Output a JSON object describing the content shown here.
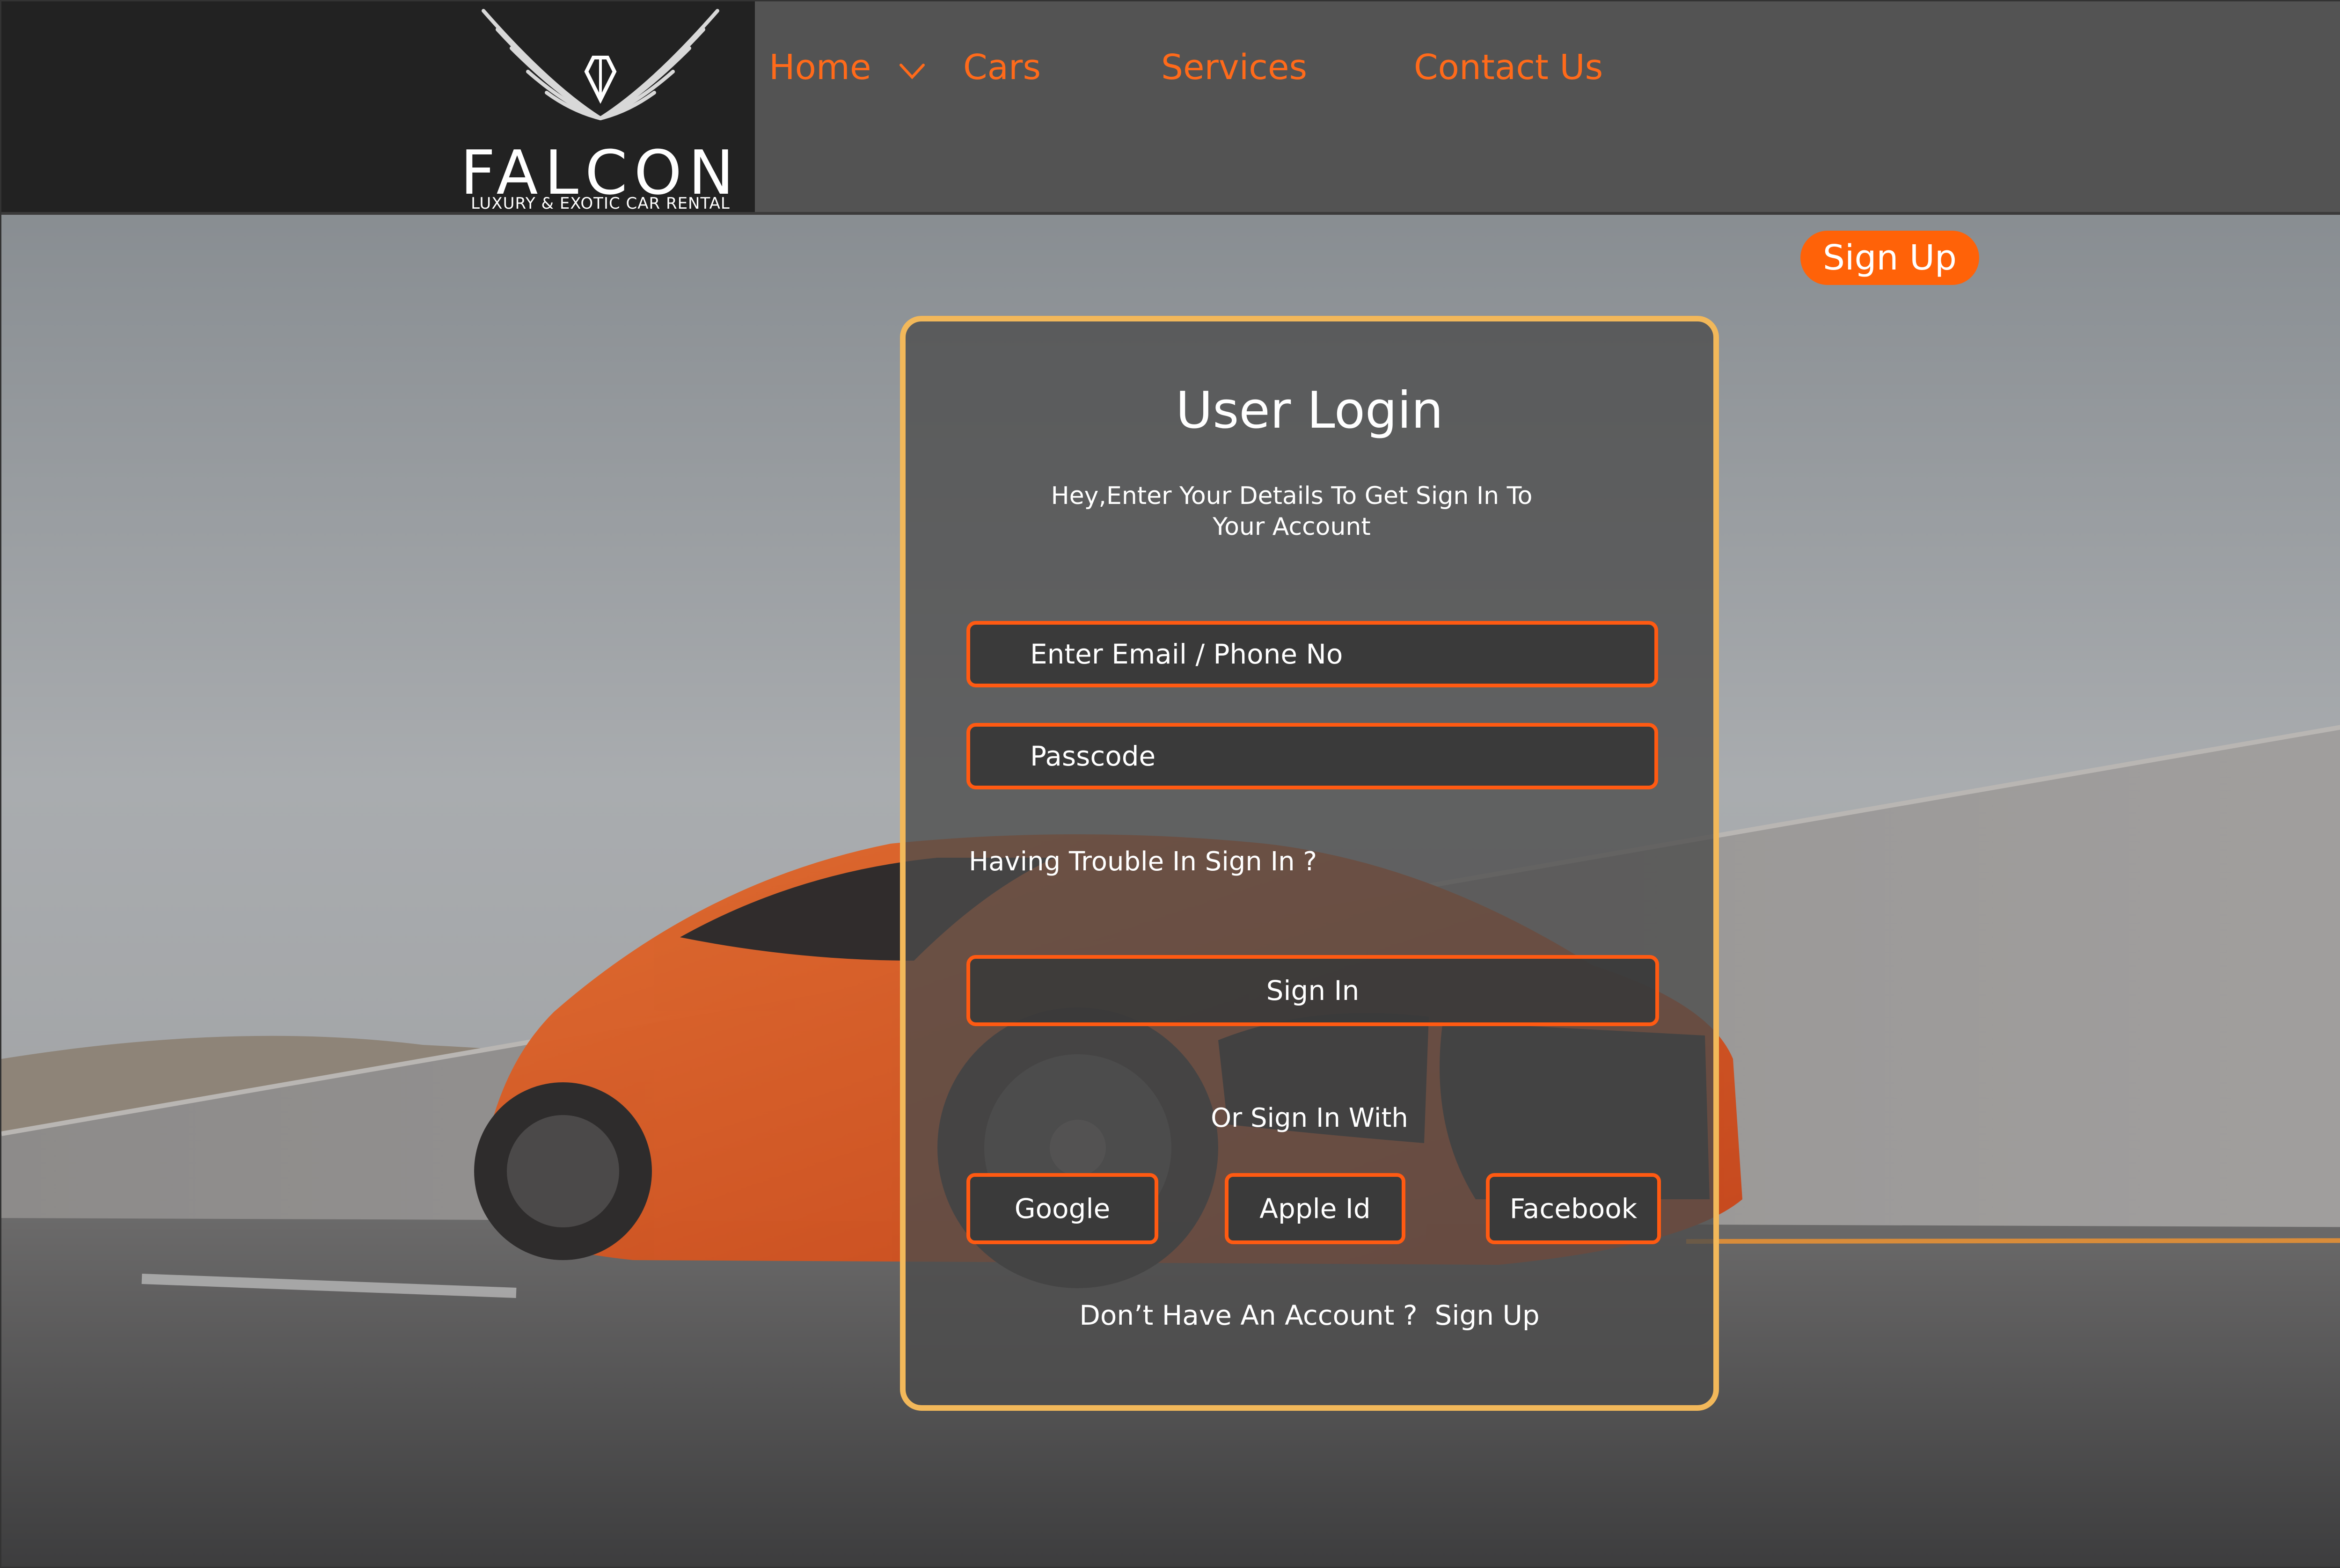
{
  "brand": {
    "name": "FALCON",
    "tagline": "LUXURY & EXOTIC CAR RENTAL"
  },
  "nav": {
    "items": [
      {
        "label": "Home"
      },
      {
        "label": "Cars"
      },
      {
        "label": "Services"
      },
      {
        "label": "Contact Us"
      }
    ]
  },
  "header_signup_label": "Sign Up",
  "login": {
    "title": "User Login",
    "subtitle": "Hey,Enter Your Details To Get Sign In To Your Account",
    "email_placeholder": "Enter Email / Phone No",
    "passcode_placeholder": "Passcode",
    "trouble_link": "Having Trouble In Sign In ?",
    "sign_in_button": "Sign In",
    "or_text": "Or Sign In With",
    "social": [
      {
        "label": "Google"
      },
      {
        "label": "Apple Id"
      },
      {
        "label": "Facebook"
      }
    ],
    "no_account_text": "Don’t Have An Account ?",
    "signup_link": "Sign Up"
  },
  "colors": {
    "accent": "#ff6208",
    "card_border": "#f2b85a",
    "header_bg": "#535353",
    "logo_bg": "#222222"
  },
  "icons": [
    "falcon-wings-logo",
    "chevron-down-icon"
  ]
}
